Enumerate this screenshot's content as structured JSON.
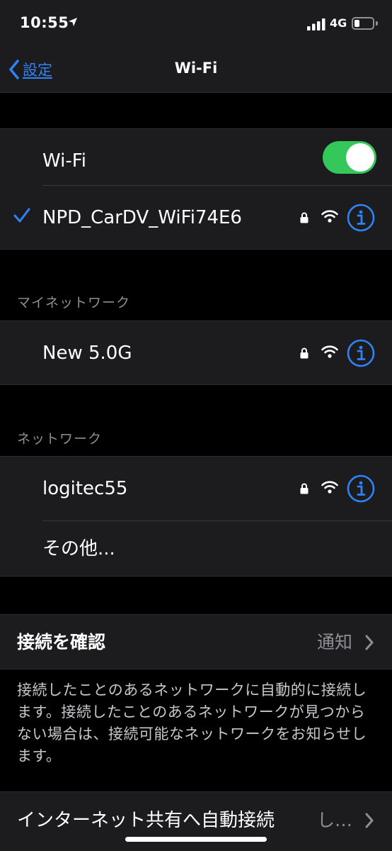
{
  "status": {
    "time": "10:55",
    "network": "4G"
  },
  "nav": {
    "back_label": "設定",
    "title": "Wi-Fi"
  },
  "wifi_toggle": {
    "label": "Wi-Fi",
    "on": true
  },
  "connected": {
    "ssid": "NPD_CarDV_WiFi74E6"
  },
  "my_networks": {
    "header": "マイネットワーク",
    "items": [
      {
        "ssid": "New 5.0G"
      }
    ]
  },
  "networks": {
    "header": "ネットワーク",
    "items": [
      {
        "ssid": "logitec55"
      }
    ],
    "other_label": "その他..."
  },
  "ask_to_join": {
    "label": "接続を確認",
    "value": "通知"
  },
  "footer_note": "接続したことのあるネットワークに自動的に接続します。接続したことのあるネットワークが見つからない場合は、接続可能なネットワークをお知らせします。",
  "auto_join_hotspot": {
    "label": "インターネット共有へ自動接続",
    "value": "し…"
  },
  "colors": {
    "accent": "#2f82f7",
    "toggle_on": "#34c759",
    "background": "#000000",
    "cell": "#1c1c1e",
    "secondary_text": "#8e8e93"
  }
}
